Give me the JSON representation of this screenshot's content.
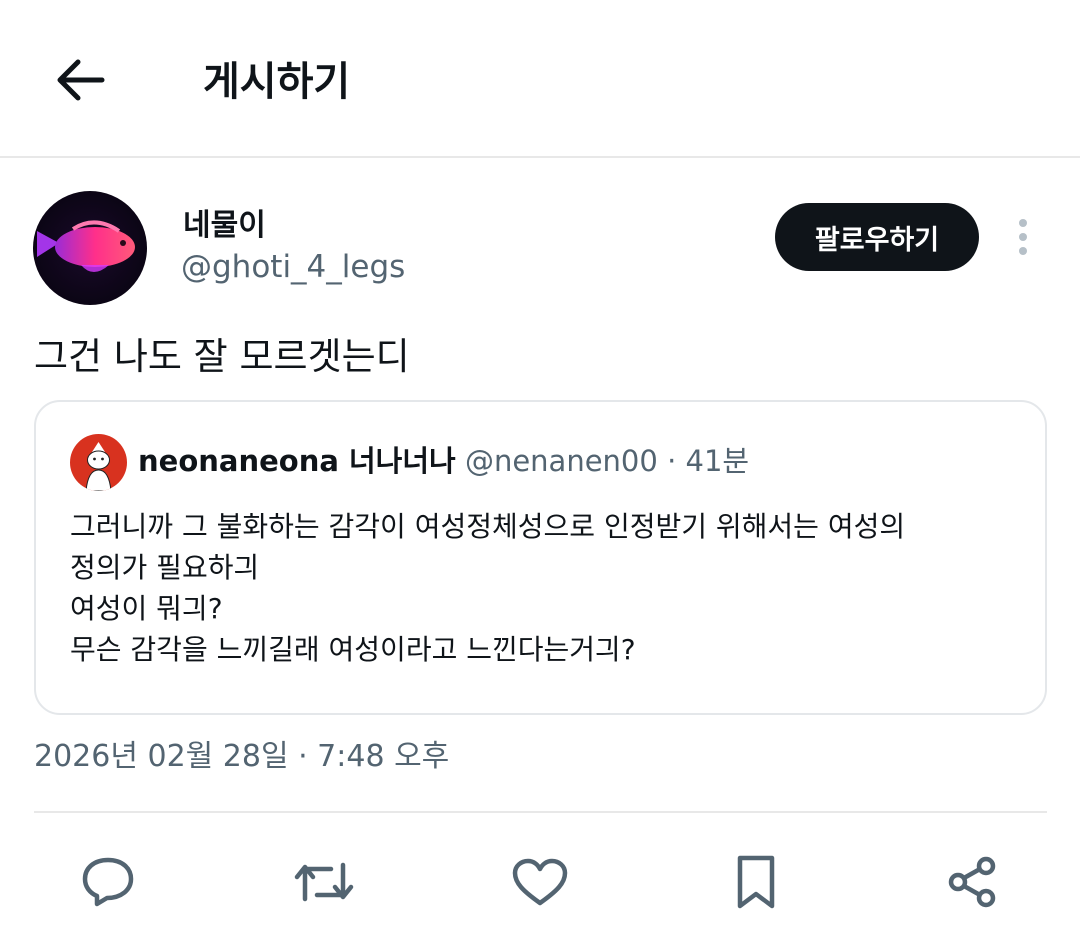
{
  "header": {
    "title": "게시하기",
    "back_icon": "arrow-left-icon"
  },
  "post": {
    "author": {
      "display_name": "네물이",
      "handle": "@ghoti_4_legs"
    },
    "follow_label": "팔로우하기",
    "more_icon": "more-vertical-icon",
    "text": "그건 나도 잘 모르겟는디",
    "timestamp": "2026년 02월 28일 · 7:48 오후"
  },
  "quote": {
    "display_name": "neonaneona 너나너나",
    "handle": "@nenanen00",
    "separator": "·",
    "time": "41분",
    "lines": [
      "그러니까 그 불화하는 감각이 여성정체성으로 인정받기 위해서는 여성의",
      "정의가 필요하긔",
      "여성이 뭐긔?",
      "무슨 감각을 느끼길래 여성이라고 느낀다는거긔?"
    ]
  },
  "actions": [
    {
      "icon": "reply-icon"
    },
    {
      "icon": "repost-icon"
    },
    {
      "icon": "like-icon"
    },
    {
      "icon": "bookmark-icon"
    },
    {
      "icon": "share-icon"
    }
  ],
  "colors": {
    "text": "#0f1419",
    "secondary": "#536471",
    "divider": "#e8e8e8",
    "follow_bg": "#0f1419"
  }
}
